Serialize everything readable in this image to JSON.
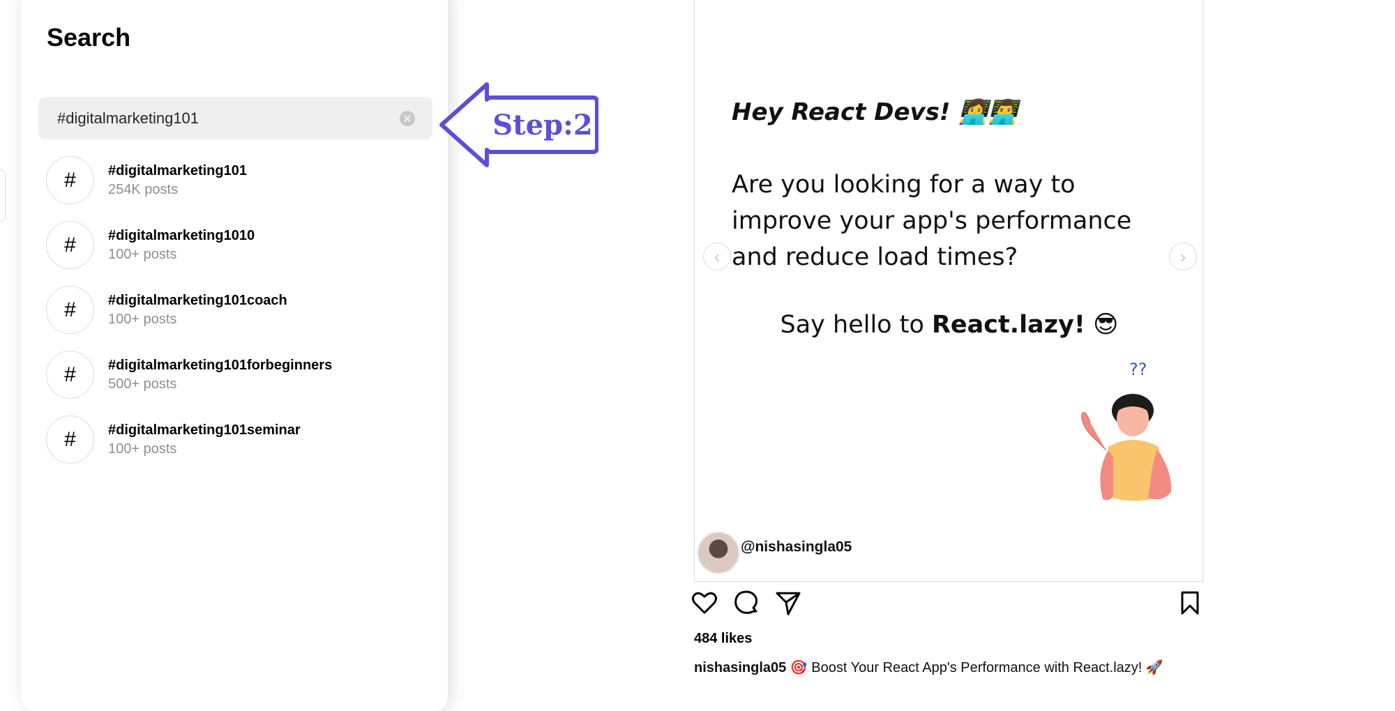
{
  "search": {
    "title": "Search",
    "query": "#digitalmarketing101",
    "results": [
      {
        "icon": "#",
        "tag": "#digitalmarketing101",
        "count": "254K posts"
      },
      {
        "icon": "#",
        "tag": "#digitalmarketing1010",
        "count": "100+ posts"
      },
      {
        "icon": "#",
        "tag": "#digitalmarketing101coach",
        "count": "100+ posts"
      },
      {
        "icon": "#",
        "tag": "#digitalmarketing101forbeginners",
        "count": "500+ posts"
      },
      {
        "icon": "#",
        "tag": "#digitalmarketing101seminar",
        "count": "100+ posts"
      }
    ]
  },
  "annotation": {
    "label": "Step:2",
    "color": "#5b4fd6"
  },
  "post": {
    "heading": "Hey React Devs! 👩‍💻👨‍💻",
    "body": "Are you looking for a way to improve your app's performance and reduce load times?",
    "hello_prefix": "Say hello to ",
    "hello_bold": "React.lazy!",
    "hello_emoji": "😎",
    "question_marks": "??",
    "image_handle": "@nishasingla05",
    "likes": "484 likes",
    "caption_user": "nishasingla05",
    "caption_text": "🎯 Boost Your React App's Performance with React.lazy! 🚀",
    "carousel_prev": "‹",
    "carousel_next": "›"
  },
  "icons": {
    "like": "heart-icon",
    "comment": "comment-icon",
    "share": "share-icon",
    "save": "bookmark-icon",
    "clear": "clear-icon"
  }
}
